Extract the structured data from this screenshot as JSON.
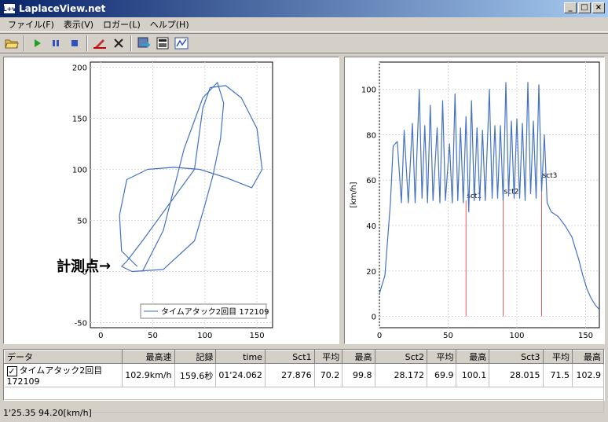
{
  "window": {
    "title": "LaplaceView.net",
    "icon_text": "L+v",
    "min": "_",
    "max": "□",
    "close": "×"
  },
  "menu": [
    "ファイル(F)",
    "表示(V)",
    "ロガー(L)",
    "ヘルプ(H)"
  ],
  "toolbar": [
    "folder-open",
    "play",
    "pause",
    "stop",
    "pen",
    "delete",
    "export",
    "layout",
    "graph"
  ],
  "annotation": {
    "text": "計測点",
    "arrow": "→"
  },
  "chart_data": [
    {
      "type": "line",
      "title": "",
      "x_ticks": [
        0,
        50,
        100,
        150
      ],
      "y_ticks": [
        -50,
        0,
        50,
        100,
        150,
        200
      ],
      "xlim": [
        -10,
        165
      ],
      "ylim": [
        -55,
        205
      ],
      "legend": {
        "label": "タイムアタック2回目  172109",
        "placement": "bottom-right"
      },
      "series": [
        {
          "name": "タイムアタック2回目  172109",
          "color": "#4472c4",
          "x": [
            35,
            20,
            18,
            25,
            45,
            70,
            95,
            120,
            145,
            155,
            150,
            135,
            120,
            105,
            98,
            90,
            65,
            40,
            25,
            20,
            30,
            60,
            90,
            100,
            108,
            115,
            118,
            112,
            98,
            80,
            60,
            40
          ],
          "y": [
            5,
            20,
            55,
            90,
            100,
            102,
            100,
            92,
            82,
            100,
            140,
            170,
            182,
            180,
            160,
            100,
            65,
            30,
            10,
            5,
            0,
            2,
            30,
            65,
            95,
            130,
            165,
            185,
            170,
            120,
            40,
            0
          ]
        }
      ]
    },
    {
      "type": "line",
      "title": "",
      "ylabel": "[km/h]",
      "x_ticks": [
        0,
        50,
        100,
        150
      ],
      "y_ticks": [
        0,
        20,
        40,
        60,
        80,
        100
      ],
      "xlim": [
        0,
        160
      ],
      "ylim": [
        -5,
        112
      ],
      "markers": [
        {
          "label": "sct1",
          "x": 63,
          "y": 51
        },
        {
          "label": "sct2",
          "x": 90,
          "y": 53
        },
        {
          "label": "sct3",
          "x": 118,
          "y": 60
        }
      ],
      "series": [
        {
          "name": "",
          "color": "#4472c4",
          "x": [
            0,
            4,
            8,
            10,
            13,
            16,
            18,
            21,
            24,
            26,
            29,
            31,
            33,
            35,
            37,
            39,
            42,
            44,
            46,
            48,
            51,
            53,
            55,
            57,
            59,
            61,
            63,
            65,
            67,
            69,
            71,
            73,
            75,
            77,
            80,
            82,
            84,
            86,
            88,
            90,
            92,
            94,
            96,
            98,
            100,
            102,
            104,
            106,
            108,
            110,
            112,
            114,
            116,
            118,
            120,
            122,
            125,
            130,
            135,
            140,
            145,
            148,
            151,
            154,
            157,
            160
          ],
          "y": [
            10,
            18,
            50,
            75,
            77,
            50,
            82,
            50,
            85,
            50,
            100,
            52,
            84,
            50,
            93,
            51,
            83,
            50,
            95,
            51,
            76,
            50,
            98,
            51,
            83,
            50,
            88,
            46,
            95,
            51,
            83,
            51,
            82,
            51,
            100,
            52,
            84,
            52,
            84,
            51,
            103,
            53,
            86,
            52,
            87,
            52,
            85,
            51,
            103,
            54,
            86,
            52,
            102,
            55,
            80,
            50,
            46,
            44,
            40,
            35,
            25,
            18,
            12,
            8,
            5,
            3
          ]
        }
      ]
    }
  ],
  "grid": {
    "columns": [
      "データ",
      "最高速",
      "記録",
      "time",
      "Sct1",
      "平均",
      "最高",
      "Sct2",
      "平均",
      "最高",
      "Sct3",
      "平均",
      "最高"
    ],
    "rows": [
      [
        "タイムアタック2回目  172109",
        "102.9km/h",
        "159.6秒",
        "01'24.062",
        "27.876",
        "70.2",
        "99.8",
        "28.172",
        "69.9",
        "100.1",
        "28.015",
        "71.5",
        "102.9"
      ]
    ],
    "check": "✓"
  },
  "status": "1'25.35  94.20[km/h]"
}
